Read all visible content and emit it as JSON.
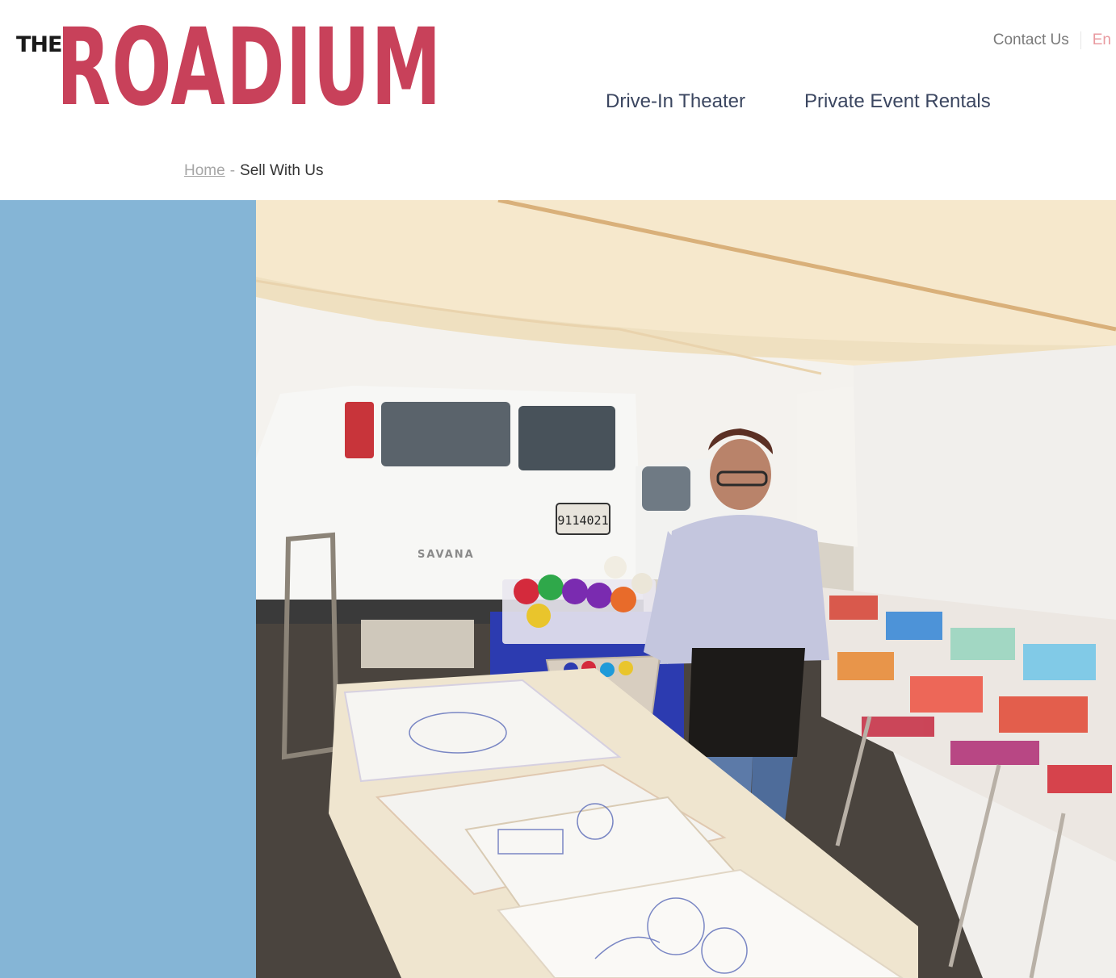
{
  "logo": {
    "prefix": "THE",
    "name": "ROADIUM"
  },
  "utility_nav": {
    "contact": "Contact Us",
    "language": "En"
  },
  "main_nav": {
    "items": [
      "Drive-In Theater",
      "Private Event Rentals"
    ]
  },
  "breadcrumb": {
    "home": "Home",
    "separator": "-",
    "current": "Sell With Us"
  },
  "hero": {
    "van_badge": "SAVANA",
    "plate": "9114021"
  },
  "colors": {
    "brand": "#c8415a",
    "nav_text": "#3b4660",
    "side_panel": "#85b5d6"
  }
}
